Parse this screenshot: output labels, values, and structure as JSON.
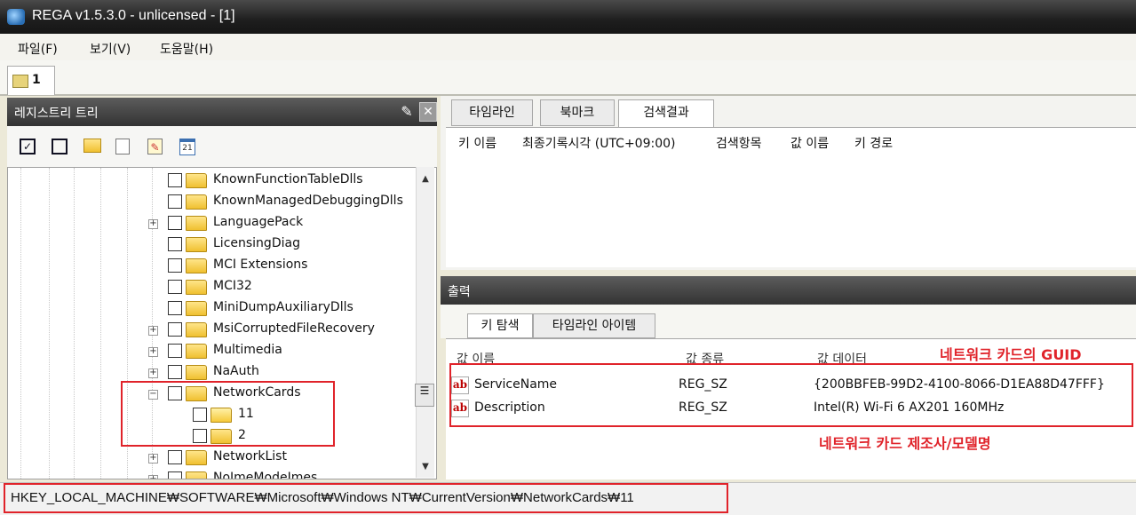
{
  "window": {
    "title": "REGA v1.5.3.0 - unlicensed - [1]"
  },
  "menu": {
    "items": [
      "파일(F)",
      "보기(V)",
      "도움말(H)"
    ]
  },
  "doc_tab": {
    "label": "1"
  },
  "registry_panel": {
    "title": "레지스트리 트리"
  },
  "tree": {
    "nodes": [
      {
        "label": "KnownFunctionTableDlls",
        "expander": ""
      },
      {
        "label": "KnownManagedDebuggingDlls",
        "expander": ""
      },
      {
        "label": "LanguagePack",
        "expander": "+"
      },
      {
        "label": "LicensingDiag",
        "expander": ""
      },
      {
        "label": "MCI Extensions",
        "expander": ""
      },
      {
        "label": "MCI32",
        "expander": ""
      },
      {
        "label": "MiniDumpAuxiliaryDlls",
        "expander": ""
      },
      {
        "label": "MsiCorruptedFileRecovery",
        "expander": "+"
      },
      {
        "label": "Multimedia",
        "expander": "+"
      },
      {
        "label": "NaAuth",
        "expander": "+"
      },
      {
        "label": "NetworkCards",
        "expander": "−"
      },
      {
        "label": "11",
        "expander": ""
      },
      {
        "label": "2",
        "expander": ""
      },
      {
        "label": "NetworkList",
        "expander": "+"
      },
      {
        "label": "NoImeModeImes",
        "expander": "+"
      }
    ]
  },
  "search_tabs": [
    "타임라인",
    "북마크",
    "검색결과"
  ],
  "search_columns": [
    "키 이름",
    "최종기록시각 (UTC+09:00)",
    "검색항목",
    "값 이름",
    "키 경로"
  ],
  "output": {
    "title": "출력",
    "tabs": [
      "키 탐색",
      "타임라인 아이템"
    ],
    "columns": [
      "값 이름",
      "값 종류",
      "값 데이터"
    ],
    "rows": [
      {
        "name": "ServiceName",
        "type": "REG_SZ",
        "data": "{200BBFEB-99D2-4100-8066-D1EA88D47FFF}"
      },
      {
        "name": "Description",
        "type": "REG_SZ",
        "data": "Intel(R) Wi-Fi 6 AX201 160MHz"
      }
    ]
  },
  "annotations": {
    "guid_note": "네트워크 카드의 GUID",
    "model_note": "네트워크 카드 제조사/모델명"
  },
  "status": {
    "path": "HKEY_LOCAL_MACHINE₩SOFTWARE₩Microsoft₩Windows NT₩CurrentVersion₩NetworkCards₩11"
  },
  "colors": {
    "accent_red": "#e0232a",
    "panel_header": "#3a3a3a"
  }
}
